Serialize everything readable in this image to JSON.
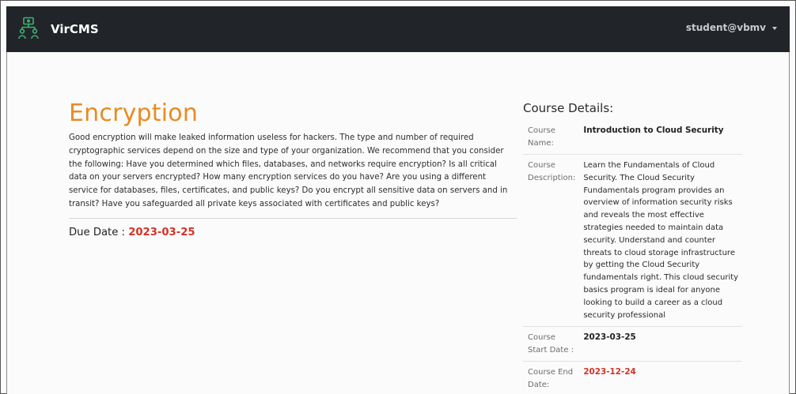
{
  "navbar": {
    "brand": "VirCMS",
    "user": "student@vbmv",
    "brand_icon": "network-nodes-icon",
    "colors": {
      "bg": "#212529",
      "icon": "#3cb371"
    }
  },
  "assignment": {
    "title": "Encryption",
    "description": "Good encryption will make leaked information useless for hackers. The type and number of required cryptographic services depend on the size and type of your organization. We recommend that you consider the following: Have you determined which files, databases, and networks require encryption? Is all critical data on your servers encrypted? How many encryption services do you have? Are you using a different service for databases, files, certificates, and public keys? Do you encrypt all sensitive data on servers and in transit? Have you safeguarded all private keys associated with certificates and public keys?",
    "due_label": "Due Date :",
    "due_date": "2023-03-25",
    "colors": {
      "title": "#e88b22",
      "date": "#d63226"
    }
  },
  "course_details": {
    "heading": "Course Details:",
    "rows": [
      {
        "label": "Course Name:",
        "value": "Introduction to Cloud Security"
      },
      {
        "label": "Course Description:",
        "value": "Learn the Fundamentals of Cloud Security. The Cloud Security Fundamentals program provides an overview of information security risks and reveals the most effective strategies needed to maintain data security. Understand and counter threats to cloud storage infrastructure by getting the Cloud Security fundamentals right. This cloud security basics program is ideal for anyone looking to build a career as a cloud security professional"
      },
      {
        "label": "Course Start Date :",
        "value": "2023-03-25"
      },
      {
        "label": "Course End Date:",
        "value": "2023-12-24"
      }
    ]
  }
}
